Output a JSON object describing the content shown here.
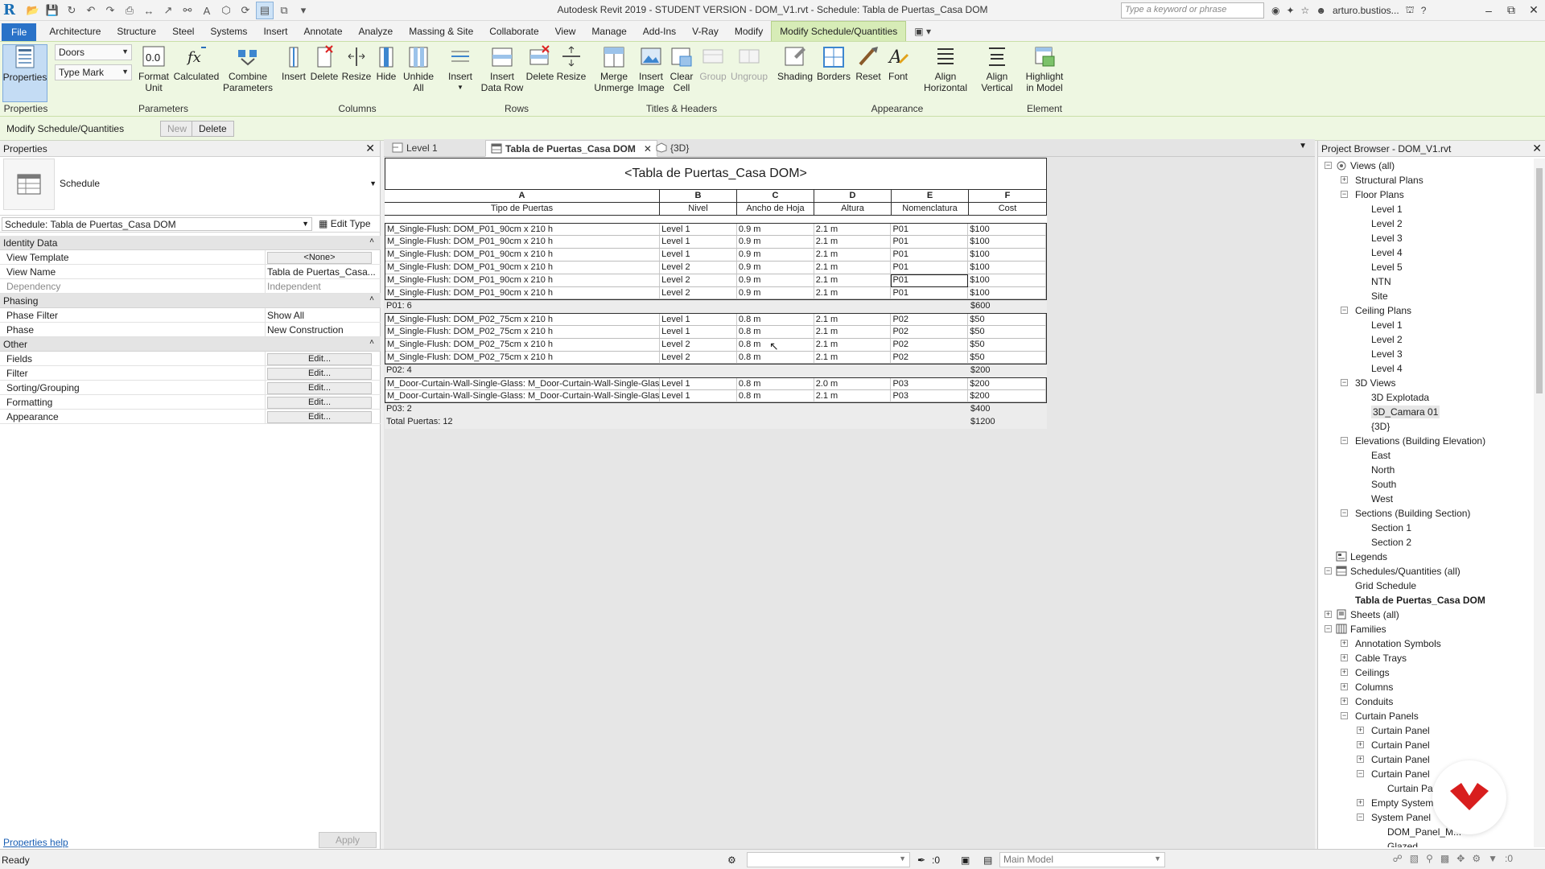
{
  "window": {
    "title": "Autodesk Revit 2019 - STUDENT VERSION - DOM_V1.rvt - Schedule: Tabla de Puertas_Casa DOM",
    "search_placeholder": "Type a keyword or phrase",
    "user": "arturo.bustios..."
  },
  "tabs": [
    "File",
    "Architecture",
    "Structure",
    "Steel",
    "Systems",
    "Insert",
    "Annotate",
    "Analyze",
    "Massing & Site",
    "Collaborate",
    "View",
    "Manage",
    "Add-Ins",
    "V-Ray",
    "Modify",
    "Modify Schedule/Quantities"
  ],
  "ribbon": {
    "properties": "Properties",
    "combo1": "Doors",
    "combo2": "Type Mark",
    "format_unit": [
      "Format",
      "Unit"
    ],
    "calculated": "Calculated",
    "combine": [
      "Combine",
      "Parameters"
    ],
    "col_insert": "Insert",
    "col_delete": "Delete",
    "col_resize": "Resize",
    "col_hide": "Hide",
    "unhide": [
      "Unhide",
      "All"
    ],
    "row_insert": "Insert",
    "insert_data_row": [
      "Insert",
      "Data Row"
    ],
    "row_delete": "Delete",
    "row_resize": "Resize",
    "merge": [
      "Merge",
      "Unmerge"
    ],
    "insert_image": [
      "Insert",
      "Image"
    ],
    "clear_cell": [
      "Clear",
      "Cell"
    ],
    "group": "Group",
    "ungroup": "Ungroup",
    "shading": "Shading",
    "borders": "Borders",
    "reset": "Reset",
    "font": "Font",
    "align_h": [
      "Align",
      "Horizontal"
    ],
    "align_v": [
      "Align",
      "Vertical"
    ],
    "highlight": [
      "Highlight",
      "in Model"
    ],
    "panels": {
      "properties": "Properties",
      "parameters": "Parameters",
      "columns": "Columns",
      "rows": "Rows",
      "titles": "Titles & Headers",
      "appearance": "Appearance",
      "element": "Element"
    }
  },
  "optionsbar": {
    "label": "Modify Schedule/Quantities",
    "new": "New",
    "delete": "Delete"
  },
  "properties": {
    "title": "Properties",
    "type_name": "Schedule",
    "selector": "Schedule: Tabla de Puertas_Casa DOM",
    "edit_type": "Edit Type",
    "groups": [
      {
        "name": "Identity Data",
        "rows": [
          {
            "k": "View Template",
            "v": "<None>",
            "button": true
          },
          {
            "k": "View Name",
            "v": "Tabla de Puertas_Casa..."
          },
          {
            "k": "Dependency",
            "v": "Independent",
            "dim": true
          }
        ]
      },
      {
        "name": "Phasing",
        "rows": [
          {
            "k": "Phase Filter",
            "v": "Show All"
          },
          {
            "k": "Phase",
            "v": "New Construction"
          }
        ]
      },
      {
        "name": "Other",
        "rows": [
          {
            "k": "Fields",
            "v": "Edit...",
            "button": true
          },
          {
            "k": "Filter",
            "v": "Edit...",
            "button": true
          },
          {
            "k": "Sorting/Grouping",
            "v": "Edit...",
            "button": true
          },
          {
            "k": "Formatting",
            "v": "Edit...",
            "button": true
          },
          {
            "k": "Appearance",
            "v": "Edit...",
            "button": true
          }
        ]
      }
    ],
    "help": "Properties help",
    "apply": "Apply"
  },
  "doctabs": [
    {
      "label": "Level 1",
      "icon": "floor-plan-icon",
      "active": false
    },
    {
      "label": "Tabla de Puertas_Casa DOM",
      "icon": "schedule-icon",
      "active": true
    },
    {
      "label": "{3D}",
      "icon": "3d-view-icon",
      "active": false
    }
  ],
  "schedule": {
    "title": "<Tabla de Puertas_Casa DOM>",
    "letters": [
      "A",
      "B",
      "C",
      "D",
      "E",
      "F"
    ],
    "headers": [
      "Tipo de Puertas",
      "Nivel",
      "Ancho de Hoja",
      "Altura",
      "Nomenclatura",
      "Cost"
    ],
    "groups": [
      {
        "rows": [
          [
            "M_Single-Flush: DOM_P01_90cm x 210 h",
            "Level 1",
            "0.9 m",
            "2.1 m",
            "P01",
            "$100"
          ],
          [
            "M_Single-Flush: DOM_P01_90cm x 210 h",
            "Level 1",
            "0.9 m",
            "2.1 m",
            "P01",
            "$100"
          ],
          [
            "M_Single-Flush: DOM_P01_90cm x 210 h",
            "Level 1",
            "0.9 m",
            "2.1 m",
            "P01",
            "$100"
          ],
          [
            "M_Single-Flush: DOM_P01_90cm x 210 h",
            "Level 2",
            "0.9 m",
            "2.1 m",
            "P01",
            "$100"
          ],
          [
            "M_Single-Flush: DOM_P01_90cm x 210 h",
            "Level 2",
            "0.9 m",
            "2.1 m",
            "P01",
            "$100"
          ],
          [
            "M_Single-Flush: DOM_P01_90cm x 210 h",
            "Level 2",
            "0.9 m",
            "2.1 m",
            "P01",
            "$100"
          ]
        ],
        "summary": "P01: 6",
        "summary_cost": "$600"
      },
      {
        "rows": [
          [
            "M_Single-Flush: DOM_P02_75cm x 210 h",
            "Level 1",
            "0.8 m",
            "2.1 m",
            "P02",
            "$50"
          ],
          [
            "M_Single-Flush: DOM_P02_75cm x 210 h",
            "Level 1",
            "0.8 m",
            "2.1 m",
            "P02",
            "$50"
          ],
          [
            "M_Single-Flush: DOM_P02_75cm x 210 h",
            "Level 2",
            "0.8 m",
            "2.1 m",
            "P02",
            "$50"
          ],
          [
            "M_Single-Flush: DOM_P02_75cm x 210 h",
            "Level 2",
            "0.8 m",
            "2.1 m",
            "P02",
            "$50"
          ]
        ],
        "summary": "P02: 4",
        "summary_cost": "$200"
      },
      {
        "rows": [
          [
            "M_Door-Curtain-Wall-Single-Glass: M_Door-Curtain-Wall-Single-Glass",
            "Level 1",
            "0.8 m",
            "2.0 m",
            "P03",
            "$200"
          ],
          [
            "M_Door-Curtain-Wall-Single-Glass: M_Door-Curtain-Wall-Single-Glass",
            "Level 1",
            "0.8 m",
            "2.1 m",
            "P03",
            "$200"
          ]
        ],
        "summary": "P03: 2",
        "summary_cost": "$400"
      }
    ],
    "total": "Total Puertas: 12",
    "total_cost": "$1200"
  },
  "browser": {
    "title": "Project Browser - DOM_V1.rvt",
    "tree": [
      {
        "t": "Views (all)",
        "lvl": 0,
        "tog": "-",
        "icon": "views-icon"
      },
      {
        "t": "Structural Plans",
        "lvl": 1,
        "tog": "+"
      },
      {
        "t": "Floor Plans",
        "lvl": 1,
        "tog": "-"
      },
      {
        "t": "Level 1",
        "lvl": 2
      },
      {
        "t": "Level 2",
        "lvl": 2
      },
      {
        "t": "Level 3",
        "lvl": 2
      },
      {
        "t": "Level 4",
        "lvl": 2
      },
      {
        "t": "Level 5",
        "lvl": 2
      },
      {
        "t": "NTN",
        "lvl": 2
      },
      {
        "t": "Site",
        "lvl": 2
      },
      {
        "t": "Ceiling Plans",
        "lvl": 1,
        "tog": "-"
      },
      {
        "t": "Level 1",
        "lvl": 2
      },
      {
        "t": "Level 2",
        "lvl": 2
      },
      {
        "t": "Level 3",
        "lvl": 2
      },
      {
        "t": "Level 4",
        "lvl": 2
      },
      {
        "t": "3D Views",
        "lvl": 1,
        "tog": "-"
      },
      {
        "t": "3D Explotada",
        "lvl": 2
      },
      {
        "t": "3D_Camara 01",
        "lvl": 2,
        "hl": true
      },
      {
        "t": "{3D}",
        "lvl": 2
      },
      {
        "t": "Elevations (Building Elevation)",
        "lvl": 1,
        "tog": "-"
      },
      {
        "t": "East",
        "lvl": 2
      },
      {
        "t": "North",
        "lvl": 2
      },
      {
        "t": "South",
        "lvl": 2
      },
      {
        "t": "West",
        "lvl": 2
      },
      {
        "t": "Sections (Building Section)",
        "lvl": 1,
        "tog": "-"
      },
      {
        "t": "Section 1",
        "lvl": 2
      },
      {
        "t": "Section 2",
        "lvl": 2
      },
      {
        "t": "Legends",
        "lvl": 0,
        "icon": "legends-icon"
      },
      {
        "t": "Schedules/Quantities (all)",
        "lvl": 0,
        "tog": "-",
        "icon": "schedules-icon"
      },
      {
        "t": "Grid Schedule",
        "lvl": 1
      },
      {
        "t": "Tabla de Puertas_Casa DOM",
        "lvl": 1,
        "bold": true
      },
      {
        "t": "Sheets (all)",
        "lvl": 0,
        "tog": "+",
        "icon": "sheets-icon"
      },
      {
        "t": "Families",
        "lvl": 0,
        "tog": "-",
        "icon": "families-icon"
      },
      {
        "t": "Annotation Symbols",
        "lvl": 1,
        "tog": "+"
      },
      {
        "t": "Cable Trays",
        "lvl": 1,
        "tog": "+"
      },
      {
        "t": "Ceilings",
        "lvl": 1,
        "tog": "+"
      },
      {
        "t": "Columns",
        "lvl": 1,
        "tog": "+"
      },
      {
        "t": "Conduits",
        "lvl": 1,
        "tog": "+"
      },
      {
        "t": "Curtain Panels",
        "lvl": 1,
        "tog": "-"
      },
      {
        "t": "Curtain Panel",
        "lvl": 2,
        "tog": "+"
      },
      {
        "t": "Curtain Panel",
        "lvl": 2,
        "tog": "+"
      },
      {
        "t": "Curtain Panel",
        "lvl": 2,
        "tog": "+"
      },
      {
        "t": "Curtain Panel",
        "lvl": 2,
        "tog": "-"
      },
      {
        "t": "Curtain Pa",
        "lvl": 3
      },
      {
        "t": "Empty System",
        "lvl": 2,
        "tog": "+"
      },
      {
        "t": "System Panel",
        "lvl": 2,
        "tog": "-"
      },
      {
        "t": "DOM_Panel_M...",
        "lvl": 3
      },
      {
        "t": "Glazed",
        "lvl": 3
      }
    ]
  },
  "status": {
    "ready": "Ready",
    "zero1": ":0",
    "model": "Main Model",
    "zero2": ":0"
  },
  "colors": {
    "ribbon_bg": "#eef7e2",
    "file_tab": "#2a72c8",
    "context_tab": "#d7ecb7",
    "badge_red": "#d81e1e"
  }
}
